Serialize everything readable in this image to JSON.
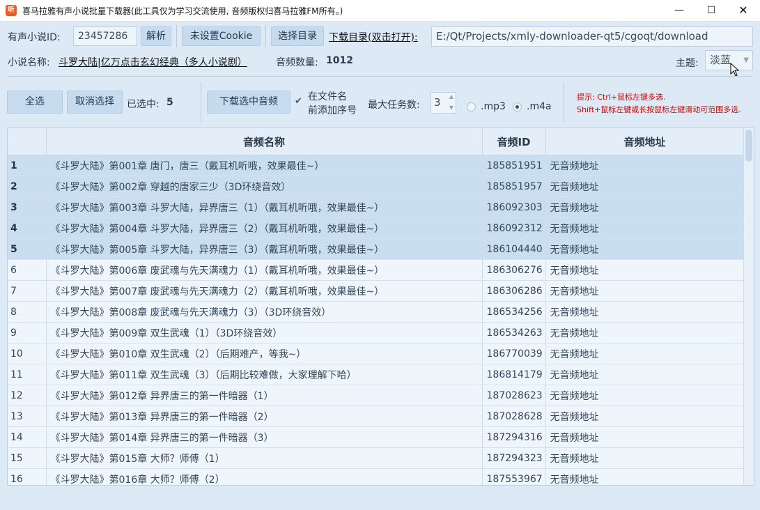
{
  "window": {
    "title": "喜马拉雅有声小说批量下载器(此工具仅为学习交流使用, 音频版权归喜马拉雅FM所有。)",
    "app_icon": "听",
    "min_glyph": "—",
    "max_glyph": "☐",
    "close_glyph": "✕"
  },
  "row1": {
    "novel_id_label": "有声小说ID:",
    "novel_id_value": "23457286",
    "parse_button": "解析",
    "cookie_button": "未设置Cookie",
    "choose_dir_button": "选择目录",
    "download_dir_label": "下载目录(双击打开):",
    "download_dir_value": "E:/Qt/Projects/xmly-downloader-qt5/cgoqt/download"
  },
  "row2": {
    "novel_name_label": "小说名称:",
    "novel_name_value": "斗罗大陆|亿万点击玄幻经典（多人小说剧）",
    "audio_count_label": "音频数量:",
    "audio_count_value": "1012",
    "theme_label": "主题:",
    "theme_value": "淡蓝"
  },
  "toolbar": {
    "select_all": "全选",
    "deselect": "取消选择",
    "selected_label": "已选中:",
    "selected_count": "5",
    "download_selected": "下载选中音频",
    "prefix_check_line1": "在文件名",
    "prefix_check_line2": "前添加序号",
    "max_tasks_label": "最大任务数:",
    "max_tasks_value": "3",
    "format_mp3": ".mp3",
    "format_m4a": ".m4a",
    "tip_line1": "提示: Ctrl+鼠标左键多选.",
    "tip_line2": "Shift+鼠标左键或长按鼠标左键滑动可范围多选."
  },
  "table": {
    "headers": [
      "",
      "音频名称",
      "音频ID",
      "音频地址"
    ],
    "rows": [
      {
        "n": "1",
        "name": "《斗罗大陆》第001章 唐门，唐三（戴耳机听哦，效果最佳~）",
        "id": "185851951",
        "url": "无音频地址"
      },
      {
        "n": "2",
        "name": "《斗罗大陆》第002章 穿越的唐家三少（3D环绕音效）",
        "id": "185851957",
        "url": "无音频地址"
      },
      {
        "n": "3",
        "name": "《斗罗大陆》第003章 斗罗大陆，异界唐三（1）（戴耳机听哦，效果最佳~）",
        "id": "186092303",
        "url": "无音频地址"
      },
      {
        "n": "4",
        "name": "《斗罗大陆》第004章 斗罗大陆，异界唐三（2）（戴耳机听哦，效果最佳~）",
        "id": "186092312",
        "url": "无音频地址"
      },
      {
        "n": "5",
        "name": "《斗罗大陆》第005章 斗罗大陆，异界唐三（3）（戴耳机听哦，效果最佳~）",
        "id": "186104440",
        "url": "无音频地址"
      },
      {
        "n": "6",
        "name": "《斗罗大陆》第006章 废武魂与先天满魂力（1）（戴耳机听哦，效果最佳~）",
        "id": "186306276",
        "url": "无音频地址"
      },
      {
        "n": "7",
        "name": "《斗罗大陆》第007章 废武魂与先天满魂力（2）（戴耳机听哦，效果最佳~）",
        "id": "186306286",
        "url": "无音频地址"
      },
      {
        "n": "8",
        "name": "《斗罗大陆》第008章 废武魂与先天满魂力（3）（3D环绕音效）",
        "id": "186534256",
        "url": "无音频地址"
      },
      {
        "n": "9",
        "name": "《斗罗大陆》第009章 双生武魂（1）（3D环绕音效）",
        "id": "186534263",
        "url": "无音频地址"
      },
      {
        "n": "10",
        "name": "《斗罗大陆》第010章 双生武魂（2）（后期难产，等我~）",
        "id": "186770039",
        "url": "无音频地址"
      },
      {
        "n": "11",
        "name": "《斗罗大陆》第011章 双生武魂（3）（后期比较难做，大家理解下哈）",
        "id": "186814179",
        "url": "无音频地址"
      },
      {
        "n": "12",
        "name": "《斗罗大陆》第012章 异界唐三的第一件暗器（1）",
        "id": "187028623",
        "url": "无音频地址"
      },
      {
        "n": "13",
        "name": "《斗罗大陆》第013章 异界唐三的第一件暗器（2）",
        "id": "187028628",
        "url": "无音频地址"
      },
      {
        "n": "14",
        "name": "《斗罗大陆》第014章 异界唐三的第一件暗器（3）",
        "id": "187294316",
        "url": "无音频地址"
      },
      {
        "n": "15",
        "name": "《斗罗大陆》第015章 大师？师傅（1）",
        "id": "187294323",
        "url": "无音频地址"
      },
      {
        "n": "16",
        "name": "《斗罗大陆》第016章 大师？师傅（2）",
        "id": "187553967",
        "url": "无音频地址"
      }
    ],
    "selected_rows": [
      "1",
      "2",
      "3",
      "4",
      "5"
    ]
  }
}
